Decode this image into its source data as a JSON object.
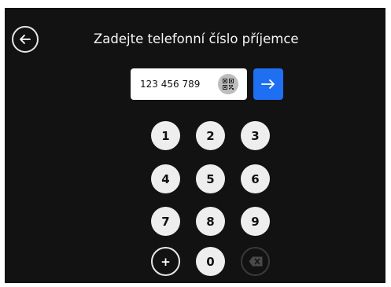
{
  "header": {
    "title": "Zadejte telefonní číslo příjemce",
    "back_icon": "arrow-left-circle-icon"
  },
  "phone_input": {
    "value": "123 456 789",
    "qr_icon": "qr-code-icon"
  },
  "submit": {
    "icon": "arrow-right-icon",
    "color": "#1f6ff2"
  },
  "keypad": {
    "keys": [
      "1",
      "2",
      "3",
      "4",
      "5",
      "6",
      "7",
      "8",
      "9",
      "+",
      "0"
    ],
    "backspace_icon": "backspace-icon"
  },
  "colors": {
    "background": "#121212",
    "key_fill": "#eeeeee",
    "accent": "#1f6ff2"
  }
}
